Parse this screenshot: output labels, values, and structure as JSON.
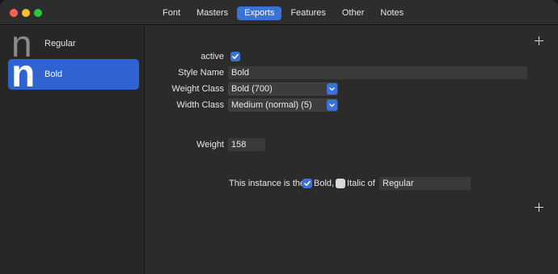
{
  "tabs": [
    {
      "label": "Font",
      "active": false
    },
    {
      "label": "Masters",
      "active": false
    },
    {
      "label": "Exports",
      "active": true
    },
    {
      "label": "Features",
      "active": false
    },
    {
      "label": "Other",
      "active": false
    },
    {
      "label": "Notes",
      "active": false
    }
  ],
  "sidebar": {
    "items": [
      {
        "glyph": "n",
        "label": "Regular",
        "selected": false
      },
      {
        "glyph": "n",
        "label": "Bold",
        "selected": true
      }
    ]
  },
  "instance": {
    "active_label": "active",
    "active_checked": true,
    "style_name_label": "Style Name",
    "style_name_value": "Bold",
    "weight_class_label": "Weight Class",
    "weight_class_value": "Bold (700)",
    "width_class_label": "Width Class",
    "width_class_value": "Medium (normal) (5)",
    "weight_label": "Weight",
    "weight_value": "158",
    "link_prefix": "This instance is the",
    "bold_label": "Bold,",
    "bold_checked": true,
    "italic_label": "Italic of",
    "italic_checked": false,
    "link_value": "Regular"
  },
  "colors": {
    "accent": "#3a73d8",
    "selection": "#2f63d2",
    "background": "#2b2b2b"
  },
  "icons": {
    "add": "plus-icon",
    "dropdown": "chevron-updown-icon",
    "check": "checkmark-icon"
  }
}
